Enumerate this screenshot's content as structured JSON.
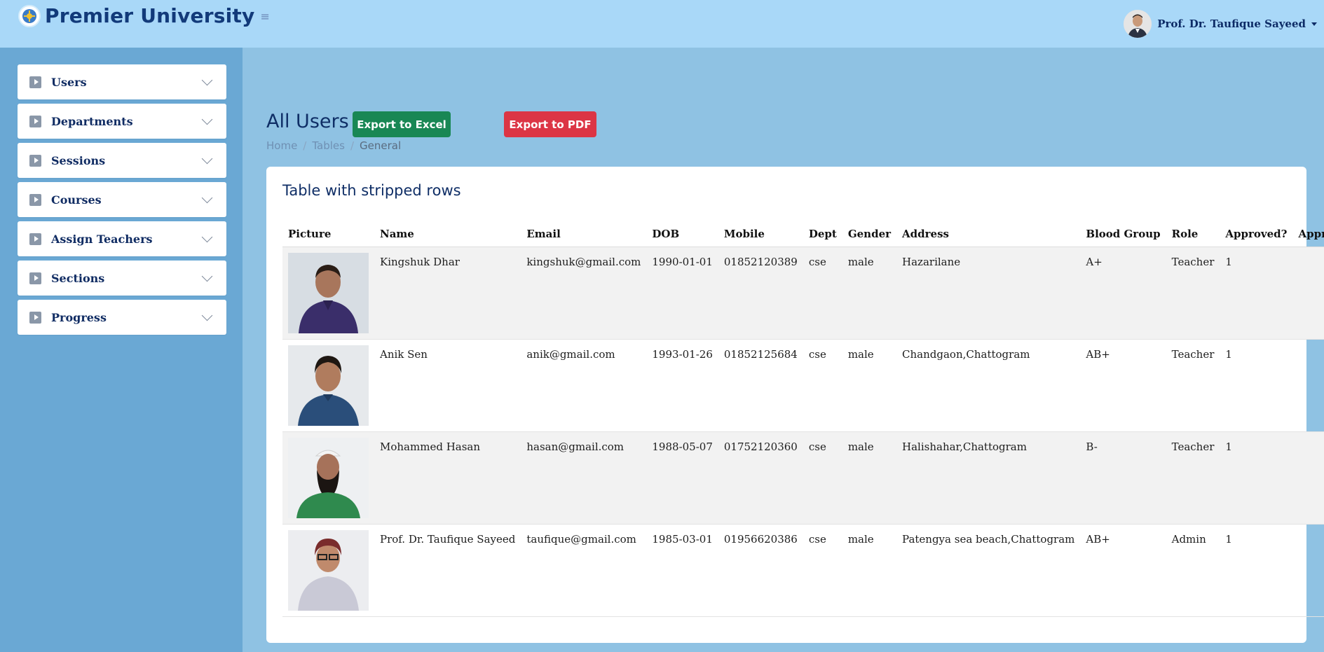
{
  "header": {
    "brand": "Premier University",
    "menu_toggle": "≡",
    "user_name": "Prof. Dr. Taufique Sayeed"
  },
  "sidebar": {
    "items": [
      {
        "label": "Users"
      },
      {
        "label": "Departments"
      },
      {
        "label": "Sessions"
      },
      {
        "label": "Courses"
      },
      {
        "label": "Assign Teachers"
      },
      {
        "label": "Sections"
      },
      {
        "label": "Progress"
      }
    ]
  },
  "main": {
    "title": "All Users",
    "export_excel": "Export to Excel",
    "export_pdf": "Export to PDF",
    "breadcrumb": [
      "Home",
      "Tables",
      "General"
    ],
    "breadcrumb_sep": "/"
  },
  "card": {
    "title": "Table with stripped rows",
    "columns": [
      "Picture",
      "Name",
      "Email",
      "DOB",
      "Mobile",
      "Dept",
      "Gender",
      "Address",
      "Blood Group",
      "Role",
      "Approved?",
      "Approved"
    ],
    "rows": [
      {
        "name": "Kingshuk Dhar",
        "email": "kingshuk@gmail.com",
        "dob": "1990-01-01",
        "mobile": "01852120389",
        "dept": "cse",
        "gender": "male",
        "address": "Hazarilane",
        "blood": "A+",
        "role": "Teacher",
        "approved_q": "1",
        "approved": ""
      },
      {
        "name": "Anik Sen",
        "email": "anik@gmail.com",
        "dob": "1993-01-26",
        "mobile": "01852125684",
        "dept": "cse",
        "gender": "male",
        "address": "Chandgaon,Chattogram",
        "blood": "AB+",
        "role": "Teacher",
        "approved_q": "1",
        "approved": ""
      },
      {
        "name": "Mohammed Hasan",
        "email": "hasan@gmail.com",
        "dob": "1988-05-07",
        "mobile": "01752120360",
        "dept": "cse",
        "gender": "male",
        "address": "Halishahar,Chattogram",
        "blood": "B-",
        "role": "Teacher",
        "approved_q": "1",
        "approved": ""
      },
      {
        "name": "Prof. Dr. Taufique Sayeed",
        "email": "taufique@gmail.com",
        "dob": "1985-03-01",
        "mobile": "01956620386",
        "dept": "cse",
        "gender": "male",
        "address": "Patengya sea beach,Chattogram",
        "blood": "AB+",
        "role": "Admin",
        "approved_q": "1",
        "approved": ""
      }
    ]
  },
  "colors": {
    "header_bg": "#a9d8f8",
    "sidebar_bg": "#6aa8d4",
    "main_bg": "#8fc2e3",
    "excel_green": "#198754",
    "pdf_red": "#dc3545"
  }
}
